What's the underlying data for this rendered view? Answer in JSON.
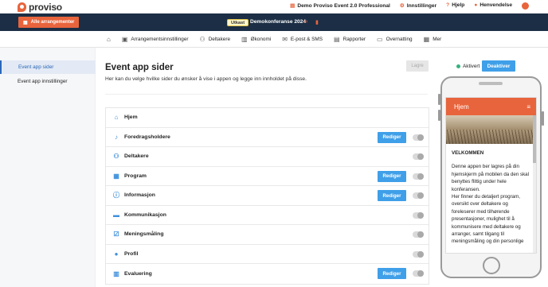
{
  "brand": {
    "name": "proviso",
    "accent": "#e8643c",
    "navy": "#1b2e45",
    "blue": "#3f9fe8"
  },
  "topnav": {
    "product": "Demo Proviso Event 2.0 Professional",
    "settings": "Innstillinger",
    "help": "Hjelp",
    "news": "Henvendelse"
  },
  "eventbar": {
    "all_events": "Alle arrangementer",
    "draft": "Utkast",
    "event_name": "Demokonferanse 2024"
  },
  "mainnav": [
    {
      "label": "",
      "icon": "home-icon"
    },
    {
      "label": "Arrangementsinnstillinger",
      "icon": "calendar-settings-icon"
    },
    {
      "label": "Deltakere",
      "icon": "people-icon"
    },
    {
      "label": "Økonomi",
      "icon": "money-icon"
    },
    {
      "label": "E-post & SMS",
      "icon": "mail-icon"
    },
    {
      "label": "Rapporter",
      "icon": "report-icon"
    },
    {
      "label": "Overnatting",
      "icon": "bed-icon"
    },
    {
      "label": "Mer",
      "icon": "grid-icon"
    }
  ],
  "sidebar": {
    "items": [
      {
        "label": "Event app sider",
        "active": true
      },
      {
        "label": "Event app innstillinger",
        "active": false
      }
    ]
  },
  "main": {
    "title": "Event app sider",
    "subtitle": "Her kan du velge hvilke sider du ønsker å vise i appen og legge inn innholdet på disse.",
    "save_label": "Lagre",
    "status_label": "Aktivert",
    "deactivate_label": "Deaktiver",
    "edit_label": "Rediger",
    "pages": [
      {
        "label": "Hjem",
        "icon": "home-icon",
        "editable": false,
        "toggle": false
      },
      {
        "label": "Foredragsholdere",
        "icon": "microphone-icon",
        "editable": true,
        "toggle": true
      },
      {
        "label": "Deltakere",
        "icon": "people-icon",
        "editable": false,
        "toggle": true
      },
      {
        "label": "Program",
        "icon": "calendar-icon",
        "editable": true,
        "toggle": true
      },
      {
        "label": "Informasjon",
        "icon": "info-icon",
        "editable": true,
        "toggle": true
      },
      {
        "label": "Kommunikasjon",
        "icon": "chat-icon",
        "editable": false,
        "toggle": true
      },
      {
        "label": "Meningsmåling",
        "icon": "checkbox-icon",
        "editable": false,
        "toggle": true
      },
      {
        "label": "Profil",
        "icon": "person-icon",
        "editable": false,
        "toggle": true
      },
      {
        "label": "Evaluering",
        "icon": "chart-icon",
        "editable": true,
        "toggle": true
      }
    ]
  },
  "phone": {
    "header": "Hjem",
    "welcome": "VELKOMMEN",
    "lines": [
      "Denne appen ber lagres på din",
      "hjemskjerm på mobilen da den skal",
      "benyttes flittig under hele",
      "konferansen.",
      "Her finner du detaljert program,",
      "oversikt over deltakere og",
      "foreleserer med tilhørende",
      "presentasjoner, mulighet til å",
      "kommunisere med deltakere og",
      "arranger, samt tilgang til",
      "meningsmåling og din personlige"
    ]
  }
}
